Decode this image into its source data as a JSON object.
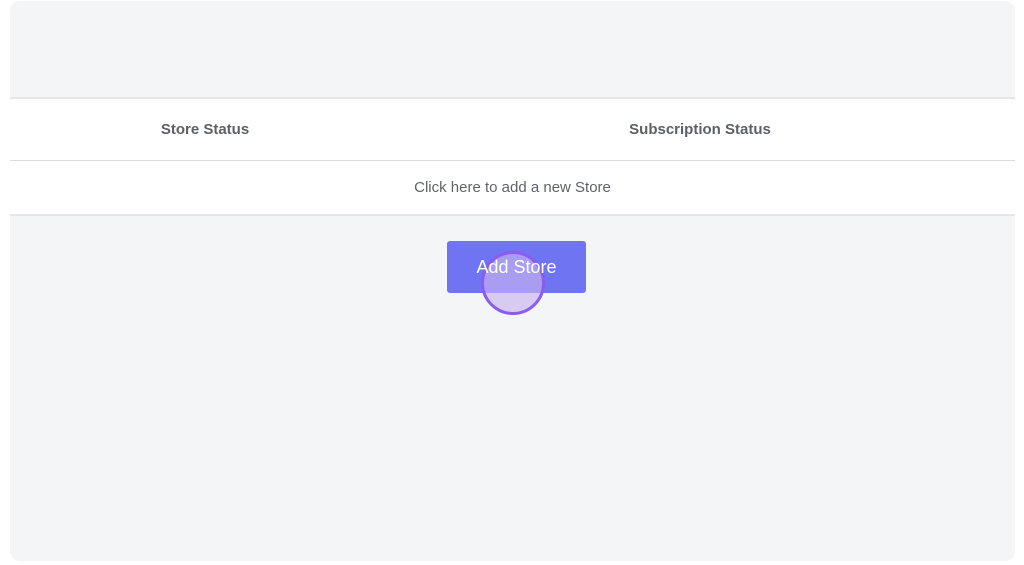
{
  "table": {
    "columns": [
      "Store Status",
      "Subscription Status"
    ],
    "empty_message": "Click here to add a new Store"
  },
  "actions": {
    "add_store_label": "Add Store"
  },
  "colors": {
    "panel_bg": "#f4f5f7",
    "button_bg": "#6f74f3",
    "cursor_highlight": "#8a5cf0"
  }
}
